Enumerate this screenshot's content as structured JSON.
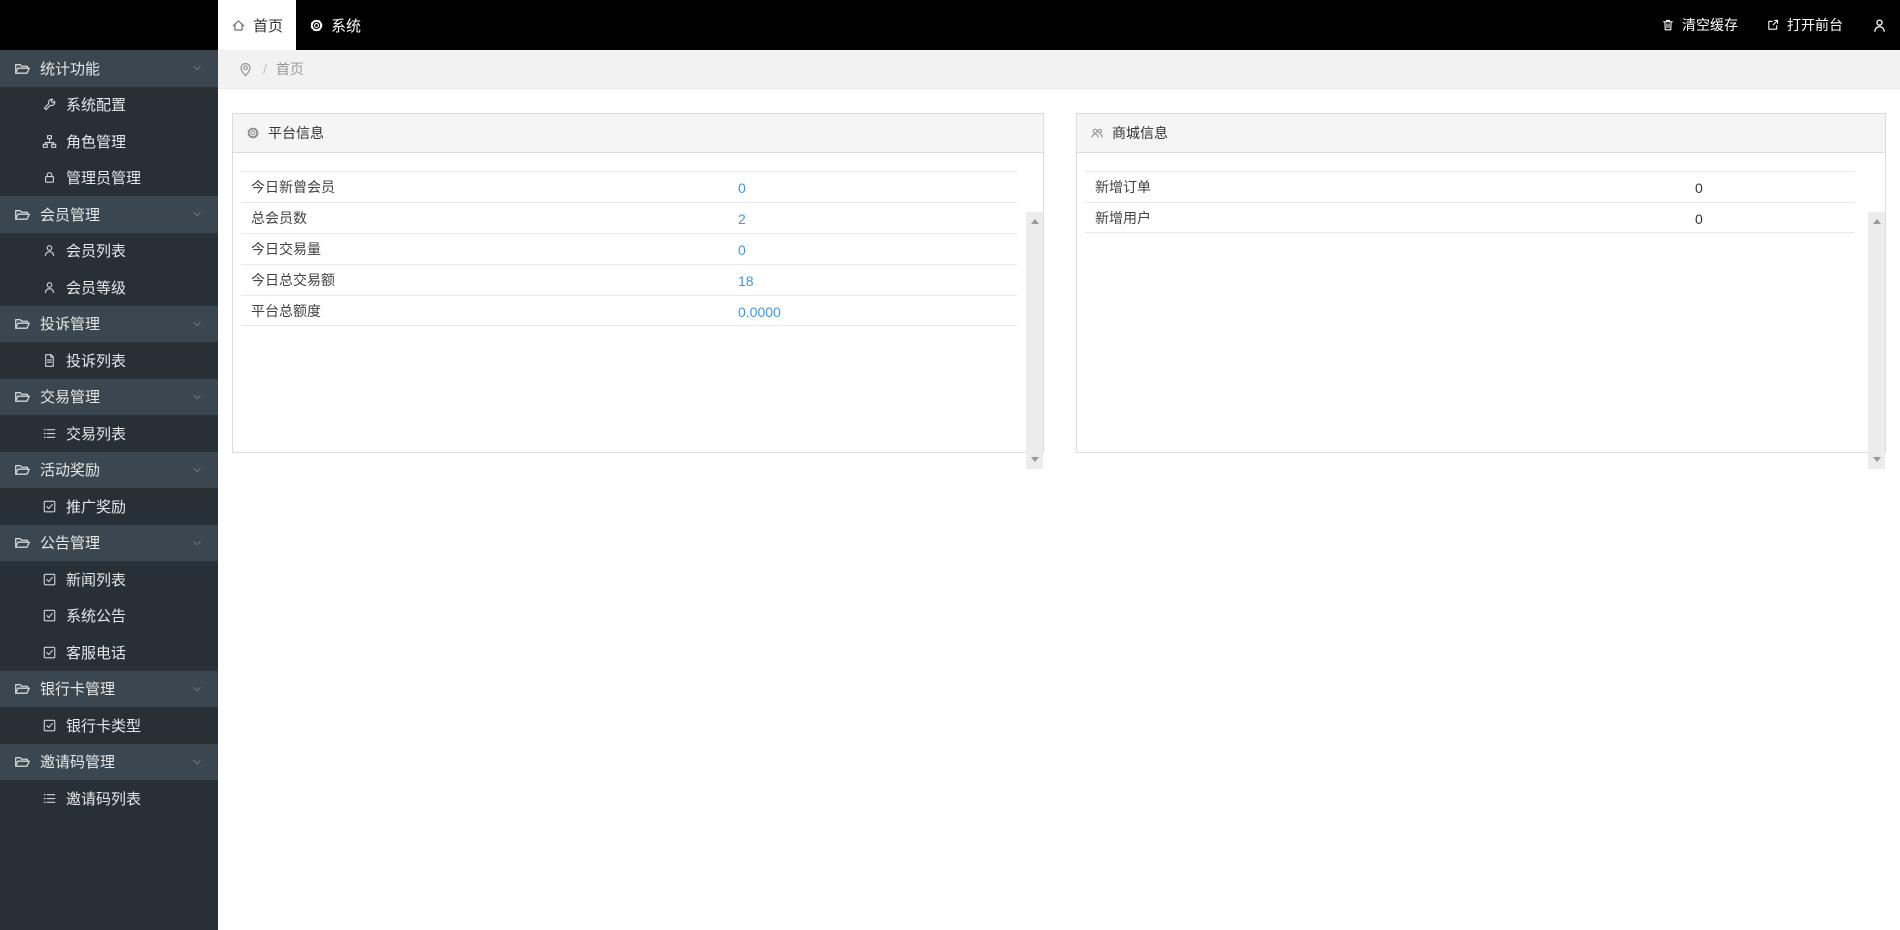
{
  "topbar": {
    "tabs": [
      {
        "name": "tab-home",
        "label": "首页",
        "icon": "home-icon",
        "active": true
      },
      {
        "name": "tab-system",
        "label": "系统",
        "icon": "gear-icon",
        "active": false
      }
    ],
    "actions": [
      {
        "name": "clear-cache-button",
        "label": "清空缓存",
        "icon": "trash-icon"
      },
      {
        "name": "open-frontend-button",
        "label": "打开前台",
        "icon": "external-link-icon"
      }
    ],
    "user": {
      "icon": "user-icon"
    }
  },
  "sidebar": {
    "items": [
      {
        "name": "sidebar-item-stats",
        "label": "统计功能",
        "type": "parent",
        "icon": "folder-open-icon"
      },
      {
        "name": "sidebar-item-system-config",
        "label": "系统配置",
        "type": "child",
        "icon": "wrench-icon"
      },
      {
        "name": "sidebar-item-role-management",
        "label": "角色管理",
        "type": "child",
        "icon": "sitemap-icon"
      },
      {
        "name": "sidebar-item-admin-management",
        "label": "管理员管理",
        "type": "child",
        "icon": "lock-icon"
      },
      {
        "name": "sidebar-item-member-management",
        "label": "会员管理",
        "type": "parent",
        "icon": "folder-open-icon"
      },
      {
        "name": "sidebar-item-member-list",
        "label": "会员列表",
        "type": "child",
        "icon": "user-icon"
      },
      {
        "name": "sidebar-item-member-level",
        "label": "会员等级",
        "type": "child",
        "icon": "user-icon"
      },
      {
        "name": "sidebar-item-complaint-management",
        "label": "投诉管理",
        "type": "parent",
        "icon": "folder-open-icon"
      },
      {
        "name": "sidebar-item-complaint-list",
        "label": "投诉列表",
        "type": "child",
        "icon": "file-text-icon"
      },
      {
        "name": "sidebar-item-trade-management",
        "label": "交易管理",
        "type": "parent",
        "icon": "folder-open-icon"
      },
      {
        "name": "sidebar-item-trade-list",
        "label": "交易列表",
        "type": "child",
        "icon": "list-icon"
      },
      {
        "name": "sidebar-item-activity-reward",
        "label": "活动奖励",
        "type": "parent",
        "icon": "folder-open-icon"
      },
      {
        "name": "sidebar-item-promotion-reward",
        "label": "推广奖励",
        "type": "child",
        "icon": "check-square-icon"
      },
      {
        "name": "sidebar-item-notice-management",
        "label": "公告管理",
        "type": "parent",
        "icon": "folder-open-icon"
      },
      {
        "name": "sidebar-item-news-list",
        "label": "新闻列表",
        "type": "child",
        "icon": "check-square-icon"
      },
      {
        "name": "sidebar-item-system-notice",
        "label": "系统公告",
        "type": "child",
        "icon": "check-square-icon"
      },
      {
        "name": "sidebar-item-service-phone",
        "label": "客服电话",
        "type": "child",
        "icon": "check-square-icon"
      },
      {
        "name": "sidebar-item-bankcard-management",
        "label": "银行卡管理",
        "type": "parent",
        "icon": "folder-open-icon"
      },
      {
        "name": "sidebar-item-bankcard-type",
        "label": "银行卡类型",
        "type": "child",
        "icon": "check-square-icon"
      },
      {
        "name": "sidebar-item-invite-code-management",
        "label": "邀请码管理",
        "type": "parent",
        "icon": "folder-open-icon"
      },
      {
        "name": "sidebar-item-invite-code-list",
        "label": "邀请码列表",
        "type": "child",
        "icon": "list-icon"
      }
    ]
  },
  "breadcrumb": {
    "icon": "location-pin-icon",
    "separator": "/",
    "current": "首页"
  },
  "panels": {
    "platform": {
      "icon": "gear-icon",
      "title": "平台信息",
      "rows": [
        {
          "label": "今日新曾会员",
          "value": "0"
        },
        {
          "label": "总会员数",
          "value": "2"
        },
        {
          "label": "今日交易量",
          "value": "0"
        },
        {
          "label": "今日总交易额",
          "value": "18"
        },
        {
          "label": "平台总额度",
          "value": "0.0000"
        }
      ]
    },
    "mall": {
      "icon": "users-icon",
      "title": "商城信息",
      "rows": [
        {
          "label": "新增订单",
          "value": "0"
        },
        {
          "label": "新增用户",
          "value": "0"
        }
      ]
    }
  },
  "colors": {
    "topbar_bg": "#000000",
    "sidebar_parent_bg": "#3a4750",
    "sidebar_child_bg": "#272f37",
    "accent_link": "#3e97e8",
    "panel_header_bg": "#f5f5f5",
    "breadcrumb_bg": "#f2f2f2"
  }
}
